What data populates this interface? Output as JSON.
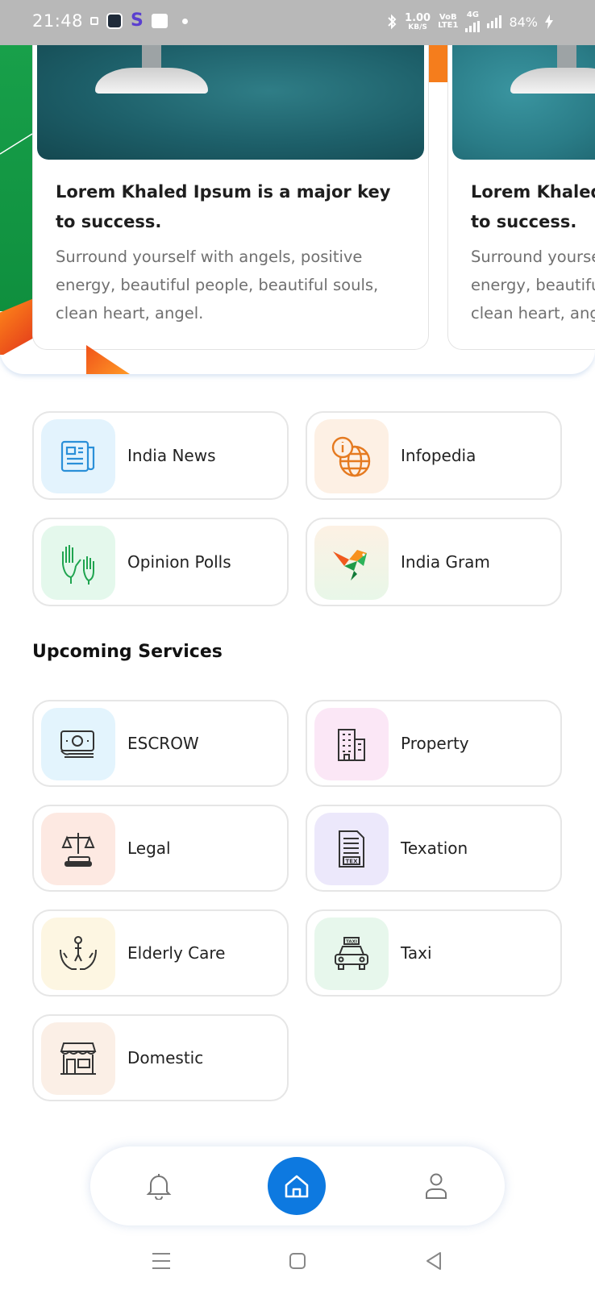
{
  "status_bar": {
    "time": "21:48",
    "speed_value": "1.00",
    "speed_unit": "KB/S",
    "volte_top": "VoB",
    "volte_bottom": "LTE1",
    "network": "4G",
    "battery": "84%"
  },
  "carousel": {
    "cards": [
      {
        "title": "Lorem Khaled Ipsum is a major key to success.",
        "text": "Surround yourself with angels, positive energy, beautiful people, beautiful souls, clean heart, angel."
      },
      {
        "title": "Lorem Khaled Ipsum is a major key to success.",
        "text": "Surround yourself with angels, positive energy, beautiful people, beautiful souls, clean heart, angel."
      }
    ]
  },
  "features": [
    {
      "label": "India News",
      "icon": "newspaper-icon"
    },
    {
      "label": "Infopedia",
      "icon": "info-globe-icon"
    },
    {
      "label": "Opinion Polls",
      "icon": "raised-hands-icon"
    },
    {
      "label": "India Gram",
      "icon": "bird-logo-icon"
    }
  ],
  "upcoming": {
    "title": "Upcoming Services",
    "items": [
      {
        "label": "ESCROW",
        "icon": "cash-icon"
      },
      {
        "label": "Property",
        "icon": "building-icon"
      },
      {
        "label": "Legal",
        "icon": "scales-icon"
      },
      {
        "label": "Texation",
        "icon": "tax-document-icon"
      },
      {
        "label": "Elderly Care",
        "icon": "care-hands-icon"
      },
      {
        "label": "Taxi",
        "icon": "taxi-icon"
      },
      {
        "label": "Domestic",
        "icon": "shop-icon"
      }
    ]
  },
  "bottom_nav": {
    "items": [
      "bell-icon",
      "home-icon",
      "user-icon"
    ],
    "active": "home",
    "accent": "#0d79e0"
  },
  "colors": {
    "news_bg": "#e3f3fd",
    "info_bg": "#fdf0e4",
    "polls_bg": "#e4f8ec",
    "gram_bg": "#fdf1e4",
    "escrow_bg": "#e3f4fd",
    "property_bg": "#fbe7f6",
    "legal_bg": "#fde9e2",
    "tax_bg": "#ece8fb",
    "elderly_bg": "#fdf6e2",
    "taxi_bg": "#e7f7ec",
    "domestic_bg": "#fbefe6"
  }
}
